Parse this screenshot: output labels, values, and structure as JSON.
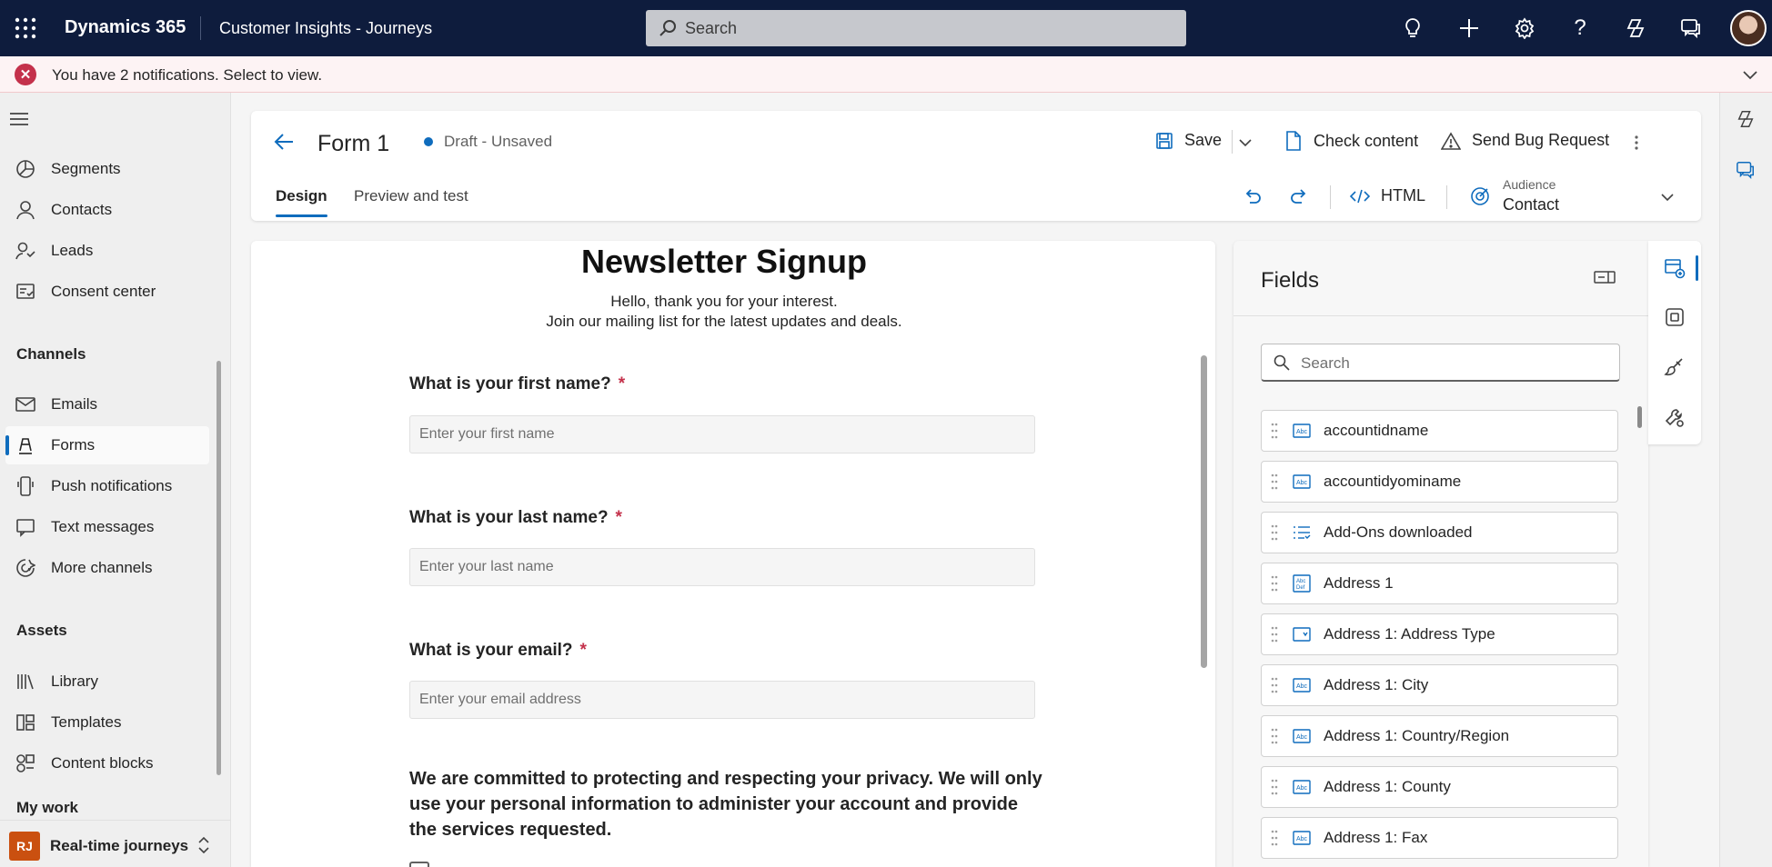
{
  "topbar": {
    "brand": "Dynamics 365",
    "app_name": "Customer Insights - Journeys",
    "search_placeholder": "Search"
  },
  "notification": {
    "text": "You have 2 notifications. Select to view."
  },
  "nav": {
    "items_top": [
      {
        "label": "Segments",
        "icon": "segments-icon"
      },
      {
        "label": "Contacts",
        "icon": "person-icon"
      },
      {
        "label": "Leads",
        "icon": "leads-icon"
      },
      {
        "label": "Consent center",
        "icon": "consent-icon"
      }
    ],
    "channels_header": "Channels",
    "channels": [
      {
        "label": "Emails",
        "icon": "mail-icon"
      },
      {
        "label": "Forms",
        "icon": "form-icon",
        "active": true
      },
      {
        "label": "Push notifications",
        "icon": "phone-icon"
      },
      {
        "label": "Text messages",
        "icon": "chat-icon"
      },
      {
        "label": "More channels",
        "icon": "more-channels-icon"
      }
    ],
    "assets_header": "Assets",
    "assets": [
      {
        "label": "Library",
        "icon": "library-icon"
      },
      {
        "label": "Templates",
        "icon": "template-icon"
      },
      {
        "label": "Content blocks",
        "icon": "content-blocks-icon"
      }
    ],
    "mywork_header": "My work",
    "area": {
      "badge": "RJ",
      "label": "Real-time journeys"
    }
  },
  "header": {
    "title": "Form 1",
    "status": "Draft - Unsaved",
    "save_label": "Save",
    "check_content_label": "Check content",
    "send_bug_label": "Send Bug Request",
    "tabs": [
      "Design",
      "Preview and test"
    ],
    "html_label": "HTML",
    "audience_label": "Audience",
    "audience_value": "Contact"
  },
  "form": {
    "title": "Newsletter Signup",
    "subtitle_line1": "Hello, thank you for your interest.",
    "subtitle_line2": "Join our mailing list for the latest updates and deals.",
    "questions": [
      {
        "label": "What is your first name?",
        "placeholder": "Enter your first name",
        "required": "*"
      },
      {
        "label": "What is your last name?",
        "placeholder": "Enter your last name",
        "required": "*"
      },
      {
        "label": "What is your email?",
        "placeholder": "Enter your email address",
        "required": "*"
      }
    ],
    "privacy_text": "We are committed to protecting and respecting your privacy. We will only use your personal information to administer your account and provide the services requested."
  },
  "fields_panel": {
    "title": "Fields",
    "search_placeholder": "Search",
    "items": [
      {
        "label": "accountidname",
        "icon": "text-field-icon"
      },
      {
        "label": "accountidyominame",
        "icon": "text-field-icon"
      },
      {
        "label": "Add-Ons downloaded",
        "icon": "list-field-icon"
      },
      {
        "label": "Address 1",
        "icon": "multiline-field-icon"
      },
      {
        "label": "Address 1: Address Type",
        "icon": "option-field-icon"
      },
      {
        "label": "Address 1: City",
        "icon": "text-field-icon"
      },
      {
        "label": "Address 1: Country/Region",
        "icon": "text-field-icon"
      },
      {
        "label": "Address 1: County",
        "icon": "text-field-icon"
      },
      {
        "label": "Address 1: Fax",
        "icon": "text-field-icon"
      }
    ]
  },
  "colors": {
    "topbar_bg": "#0e1c3d",
    "accent": "#0f6cbd",
    "error": "#c4314b",
    "area_badge": "#ca5010"
  }
}
